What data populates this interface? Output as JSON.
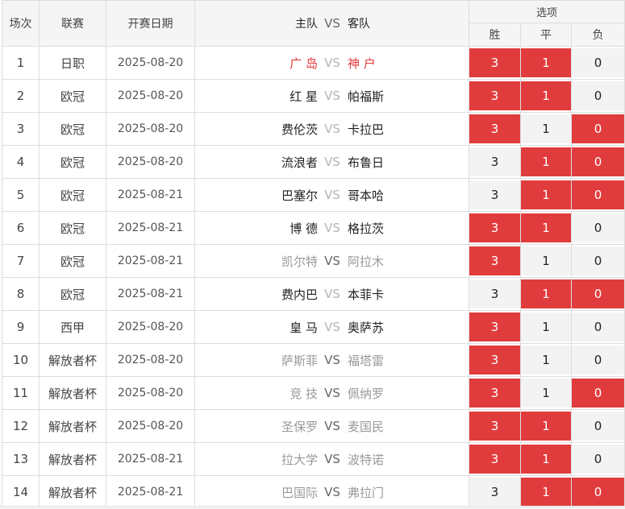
{
  "header": {
    "col_round": "场次",
    "col_league": "联赛",
    "col_date": "开赛日期",
    "col_home": "主队",
    "col_vs": "VS",
    "col_away": "客队",
    "col_options": "选项",
    "opt_win": "胜",
    "opt_draw": "平",
    "opt_loss": "负"
  },
  "colors": {
    "selected_bg": "#e13c3d",
    "unselected_bg": "#f3f3f3",
    "header_bg": "#f5f5f5"
  },
  "rows": [
    {
      "no": "1",
      "league": "日职",
      "date": "2025-08-20",
      "home": "广 岛",
      "vs": "VS",
      "away": "神 户",
      "home_style": "red",
      "away_style": "red",
      "vs_style": "light",
      "win": "3",
      "draw": "1",
      "loss": "0",
      "win_sel": true,
      "draw_sel": true,
      "loss_sel": false
    },
    {
      "no": "2",
      "league": "欧冠",
      "date": "2025-08-20",
      "home": "红 星",
      "vs": "VS",
      "away": "帕福斯",
      "home_style": "dark",
      "away_style": "dark",
      "vs_style": "light",
      "win": "3",
      "draw": "1",
      "loss": "0",
      "win_sel": true,
      "draw_sel": true,
      "loss_sel": false
    },
    {
      "no": "3",
      "league": "欧冠",
      "date": "2025-08-20",
      "home": "费伦茨",
      "vs": "VS",
      "away": "卡拉巴",
      "home_style": "dark",
      "away_style": "dark",
      "vs_style": "light",
      "win": "3",
      "draw": "1",
      "loss": "0",
      "win_sel": true,
      "draw_sel": false,
      "loss_sel": true
    },
    {
      "no": "4",
      "league": "欧冠",
      "date": "2025-08-20",
      "home": "流浪者",
      "vs": "VS",
      "away": "布鲁日",
      "home_style": "dark",
      "away_style": "dark",
      "vs_style": "light",
      "win": "3",
      "draw": "1",
      "loss": "0",
      "win_sel": false,
      "draw_sel": true,
      "loss_sel": true
    },
    {
      "no": "5",
      "league": "欧冠",
      "date": "2025-08-21",
      "home": "巴塞尔",
      "vs": "VS",
      "away": "哥本哈",
      "home_style": "dark",
      "away_style": "dark",
      "vs_style": "light",
      "win": "3",
      "draw": "1",
      "loss": "0",
      "win_sel": false,
      "draw_sel": true,
      "loss_sel": true
    },
    {
      "no": "6",
      "league": "欧冠",
      "date": "2025-08-21",
      "home": "博 德",
      "vs": "VS",
      "away": "格拉茨",
      "home_style": "dark",
      "away_style": "dark",
      "vs_style": "light",
      "win": "3",
      "draw": "1",
      "loss": "0",
      "win_sel": true,
      "draw_sel": true,
      "loss_sel": false
    },
    {
      "no": "7",
      "league": "欧冠",
      "date": "2025-08-21",
      "home": "凯尔特",
      "vs": "VS",
      "away": "阿拉木",
      "home_style": "gray",
      "away_style": "gray",
      "vs_style": "dark",
      "win": "3",
      "draw": "1",
      "loss": "0",
      "win_sel": true,
      "draw_sel": false,
      "loss_sel": false
    },
    {
      "no": "8",
      "league": "欧冠",
      "date": "2025-08-21",
      "home": "费内巴",
      "vs": "VS",
      "away": "本菲卡",
      "home_style": "dark",
      "away_style": "dark",
      "vs_style": "light",
      "win": "3",
      "draw": "1",
      "loss": "0",
      "win_sel": false,
      "draw_sel": true,
      "loss_sel": true
    },
    {
      "no": "9",
      "league": "西甲",
      "date": "2025-08-20",
      "home": "皇 马",
      "vs": "VS",
      "away": "奥萨苏",
      "home_style": "dark",
      "away_style": "dark",
      "vs_style": "light",
      "win": "3",
      "draw": "1",
      "loss": "0",
      "win_sel": true,
      "draw_sel": false,
      "loss_sel": false
    },
    {
      "no": "10",
      "league": "解放者杯",
      "date": "2025-08-20",
      "home": "萨斯菲",
      "vs": "VS",
      "away": "福塔雷",
      "home_style": "gray",
      "away_style": "gray",
      "vs_style": "dark",
      "win": "3",
      "draw": "1",
      "loss": "0",
      "win_sel": true,
      "draw_sel": false,
      "loss_sel": false
    },
    {
      "no": "11",
      "league": "解放者杯",
      "date": "2025-08-20",
      "home": "竞 技",
      "vs": "VS",
      "away": "佩纳罗",
      "home_style": "gray",
      "away_style": "gray",
      "vs_style": "dark",
      "win": "3",
      "draw": "1",
      "loss": "0",
      "win_sel": true,
      "draw_sel": false,
      "loss_sel": true
    },
    {
      "no": "12",
      "league": "解放者杯",
      "date": "2025-08-20",
      "home": "圣保罗",
      "vs": "VS",
      "away": "麦国民",
      "home_style": "gray",
      "away_style": "gray",
      "vs_style": "dark",
      "win": "3",
      "draw": "1",
      "loss": "0",
      "win_sel": true,
      "draw_sel": true,
      "loss_sel": false
    },
    {
      "no": "13",
      "league": "解放者杯",
      "date": "2025-08-21",
      "home": "拉大学",
      "vs": "VS",
      "away": "波特诺",
      "home_style": "gray",
      "away_style": "gray",
      "vs_style": "dark",
      "win": "3",
      "draw": "1",
      "loss": "0",
      "win_sel": true,
      "draw_sel": true,
      "loss_sel": false
    },
    {
      "no": "14",
      "league": "解放者杯",
      "date": "2025-08-21",
      "home": "巴国际",
      "vs": "VS",
      "away": "弗拉门",
      "home_style": "gray",
      "away_style": "gray",
      "vs_style": "dark",
      "win": "3",
      "draw": "1",
      "loss": "0",
      "win_sel": false,
      "draw_sel": true,
      "loss_sel": true
    }
  ]
}
